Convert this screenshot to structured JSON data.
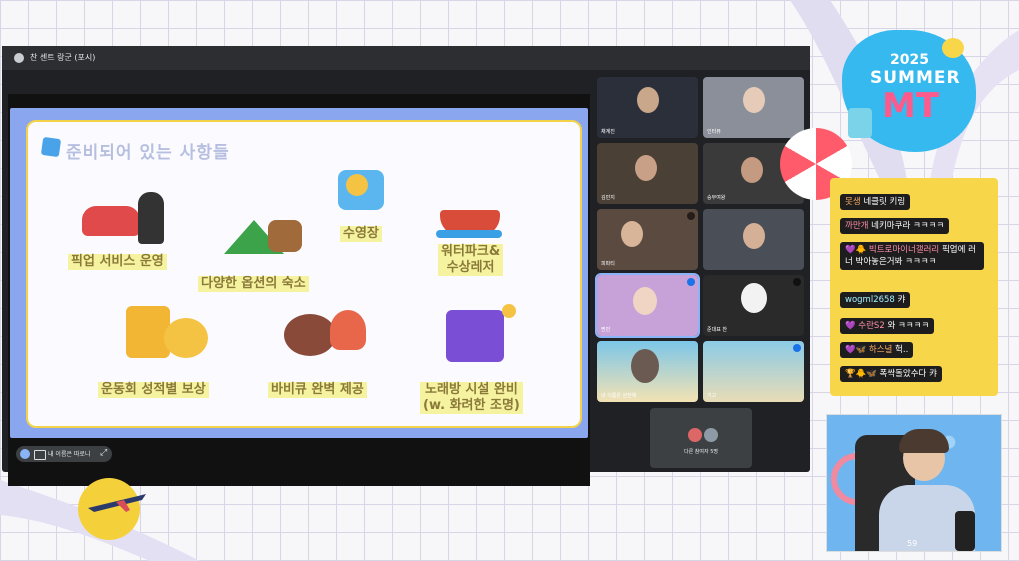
{
  "window": {
    "title": "찬 센트 랑군 (포시)"
  },
  "slide": {
    "title": "준비되어 있는 사항들",
    "items": [
      {
        "label": "픽업 서비스 운영",
        "art_color": "#e04a4a"
      },
      {
        "label": "다양한 옵션의 숙소",
        "art_color": "#3da34a"
      },
      {
        "label": "수영장",
        "art_color": "#2e8ae6"
      },
      {
        "label": "워터파크&\n수상레저",
        "art_color": "#d94c3a"
      },
      {
        "label": "운동회 성적별 보상",
        "art_color": "#f2b534"
      },
      {
        "label": "바비큐 완벽 제공",
        "art_color": "#8a4a3a"
      },
      {
        "label": "노래방 시설 완비\n(w. 화려한 조명)",
        "art_color": "#7a4fd6"
      }
    ]
  },
  "bottom_bar": {
    "label": "내 이름은 따로니"
  },
  "participants": [
    {
      "name": "채계진",
      "bg": "#2b2f3a"
    },
    {
      "name": "인터뷰",
      "bg": "#8a8f99"
    },
    {
      "name": "김민지",
      "bg": "#4a4036"
    },
    {
      "name": "승부여왕",
      "bg": "#3a3a3a"
    },
    {
      "name": "피파티",
      "bg": "#5a4a40"
    },
    {
      "name": "",
      "bg": "#4a4f57"
    },
    {
      "name": "찐빈",
      "bg": "#c7a2d8"
    },
    {
      "name": "준대표 찬",
      "bg": "#e7e7e7"
    },
    {
      "name": "내 이름은 완전체",
      "bg": "#5aa6c8"
    },
    {
      "name": "기고",
      "bg": "#6fb2d1"
    }
  ],
  "others": {
    "label": "다른 참여자 5명"
  },
  "logo": {
    "year": "2025",
    "line1": "SUMMER",
    "line2": "MT"
  },
  "chat": [
    {
      "user": "못생",
      "text": "네클릿 키링"
    },
    {
      "user": "까만개",
      "text": "네키마쿠라 ㅋㅋㅋㅋ"
    },
    {
      "user": "빅트로마이너갤러리",
      "text": "픽업에 러너 박아놓은거봐 ㅋㅋㅋㅋ",
      "prefix": "💜🐥 "
    },
    {
      "user": "wogml2658",
      "text": "캬"
    },
    {
      "user": "수란S2",
      "text": "와 ㅋㅋㅋㅋ",
      "prefix": "💜 "
    },
    {
      "user": "하스녈",
      "text": "헉..",
      "prefix": "💜🦋 "
    },
    {
      "user": "",
      "text": "폭싹돌았수다 캬",
      "prefix": "🏆🐥🦋 "
    }
  ],
  "cam": {
    "counter": "59"
  }
}
